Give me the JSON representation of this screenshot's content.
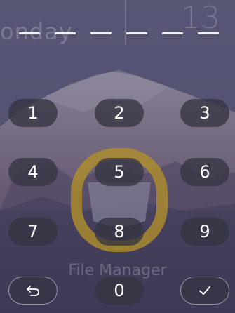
{
  "lockscreen_background": {
    "day_text": "onday",
    "time_text": "13",
    "app_label": "File Manager"
  },
  "pin": {
    "slots": 6
  },
  "keypad": {
    "keys": [
      "1",
      "2",
      "3",
      "4",
      "5",
      "6",
      "7",
      "8",
      "9",
      "0"
    ],
    "back_icon": "back-icon",
    "confirm_icon": "check-icon"
  },
  "colors": {
    "overlay": "#46466a",
    "key_background": "#343442",
    "text": "#ffffff",
    "ring_accent": "#b08f2a"
  }
}
